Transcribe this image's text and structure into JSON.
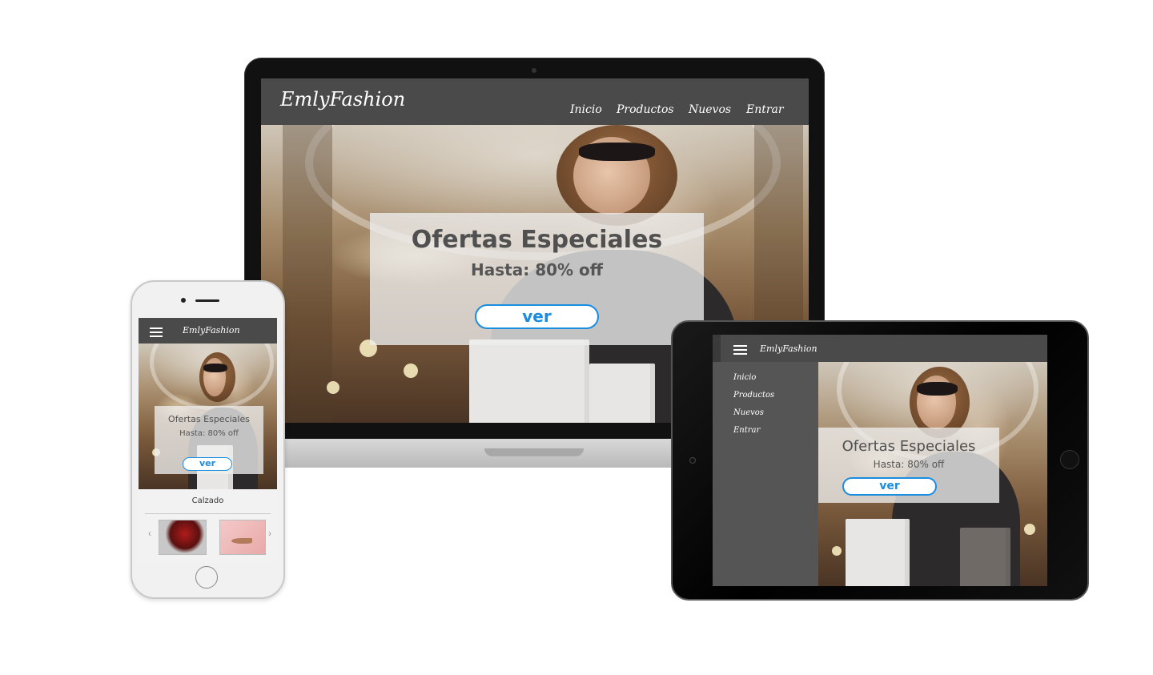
{
  "brand": "EmlyFashion",
  "laptop": {
    "brand": "EmlyFashion",
    "nav": [
      "Inicio",
      "Productos",
      "Nuevos",
      "Entrar"
    ],
    "offer_title": "Ofertas Especiales",
    "offer_sub": "Hasta: 80% off",
    "button": "ver"
  },
  "phone": {
    "brand": "EmlyFashion",
    "offer_title": "Ofertas Especiales",
    "offer_sub": "Hasta: 80% off",
    "button": "ver",
    "section_title": "Calzado",
    "prev_arrow": "‹",
    "next_arrow": "›"
  },
  "tablet": {
    "brand": "EmlyFashion",
    "menu": [
      "Inicio",
      "Productos",
      "Nuevos",
      "Entrar"
    ],
    "offer_title": "Ofertas Especiales",
    "offer_sub": "Hasta: 80% off",
    "button": "ver"
  },
  "colors": {
    "nav_bg": "#4a4a4a",
    "button_accent": "#1a8de0",
    "overlay": "#eeeeee"
  },
  "icons": [
    "hamburger-icon",
    "chevron-left-icon",
    "chevron-right-icon"
  ]
}
